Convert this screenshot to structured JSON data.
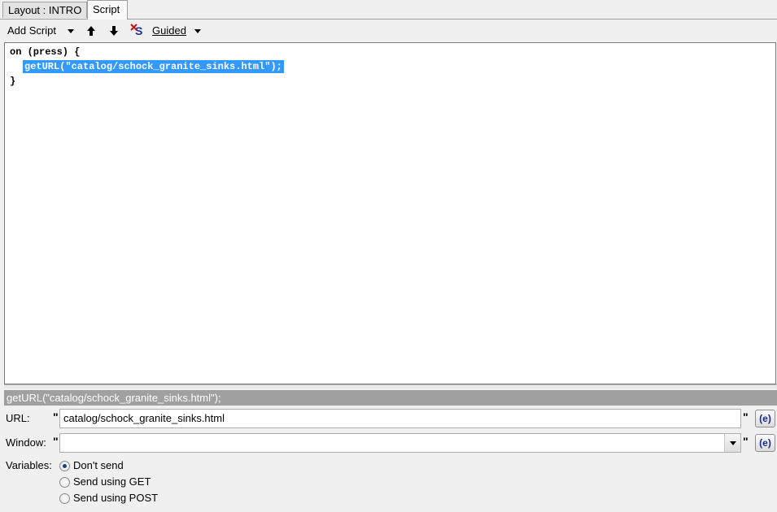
{
  "tabs": [
    {
      "label": "Layout : INTRO"
    },
    {
      "label": "Script"
    }
  ],
  "toolbar": {
    "add_script_label": "Add Script",
    "guided_label": "Guided"
  },
  "editor": {
    "lines": [
      "on (press) {",
      "getURL(\"catalog/schock_granite_sinks.html\");",
      "}"
    ]
  },
  "status": {
    "text": "getURL(\"catalog/schock_granite_sinks.html\");"
  },
  "params": {
    "url_label": "URL:",
    "url_value": "catalog/schock_granite_sinks.html",
    "window_label": "Window:",
    "window_value": "",
    "quote_char": "\"",
    "expr_button_label": "(e)",
    "variables_label": "Variables:",
    "variables_options": [
      "Don't send",
      "Send using GET",
      "Send using POST"
    ],
    "variables_selected": "Don't send"
  },
  "colors": {
    "selection": "#3399ff",
    "status_bg": "#a0a0a0"
  }
}
